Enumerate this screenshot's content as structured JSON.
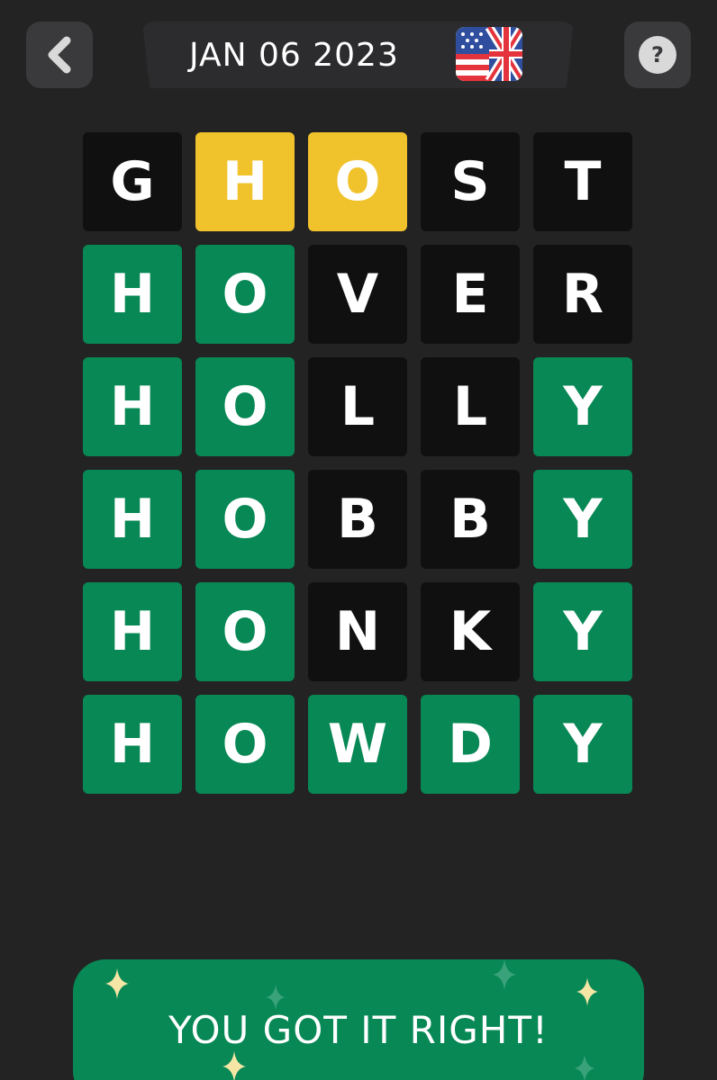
{
  "header": {
    "date": "JAN 06 2023",
    "back_icon": "chevron-left-icon",
    "help_label": "?",
    "flag_icon": "us-uk-flag-icon"
  },
  "colors": {
    "background": "#232323",
    "absent": "#101010",
    "present": "#f0c22c",
    "correct": "#078855"
  },
  "board": {
    "rows": [
      {
        "letters": [
          "G",
          "H",
          "O",
          "S",
          "T"
        ],
        "states": [
          "absent",
          "present",
          "present",
          "absent",
          "absent"
        ]
      },
      {
        "letters": [
          "H",
          "O",
          "V",
          "E",
          "R"
        ],
        "states": [
          "correct",
          "correct",
          "absent",
          "absent",
          "absent"
        ]
      },
      {
        "letters": [
          "H",
          "O",
          "L",
          "L",
          "Y"
        ],
        "states": [
          "correct",
          "correct",
          "absent",
          "absent",
          "correct"
        ]
      },
      {
        "letters": [
          "H",
          "O",
          "B",
          "B",
          "Y"
        ],
        "states": [
          "correct",
          "correct",
          "absent",
          "absent",
          "correct"
        ]
      },
      {
        "letters": [
          "H",
          "O",
          "N",
          "K",
          "Y"
        ],
        "states": [
          "correct",
          "correct",
          "absent",
          "absent",
          "correct"
        ]
      },
      {
        "letters": [
          "H",
          "O",
          "W",
          "D",
          "Y"
        ],
        "states": [
          "correct",
          "correct",
          "correct",
          "correct",
          "correct"
        ]
      }
    ]
  },
  "result": {
    "message": "YOU GOT IT RIGHT!"
  }
}
